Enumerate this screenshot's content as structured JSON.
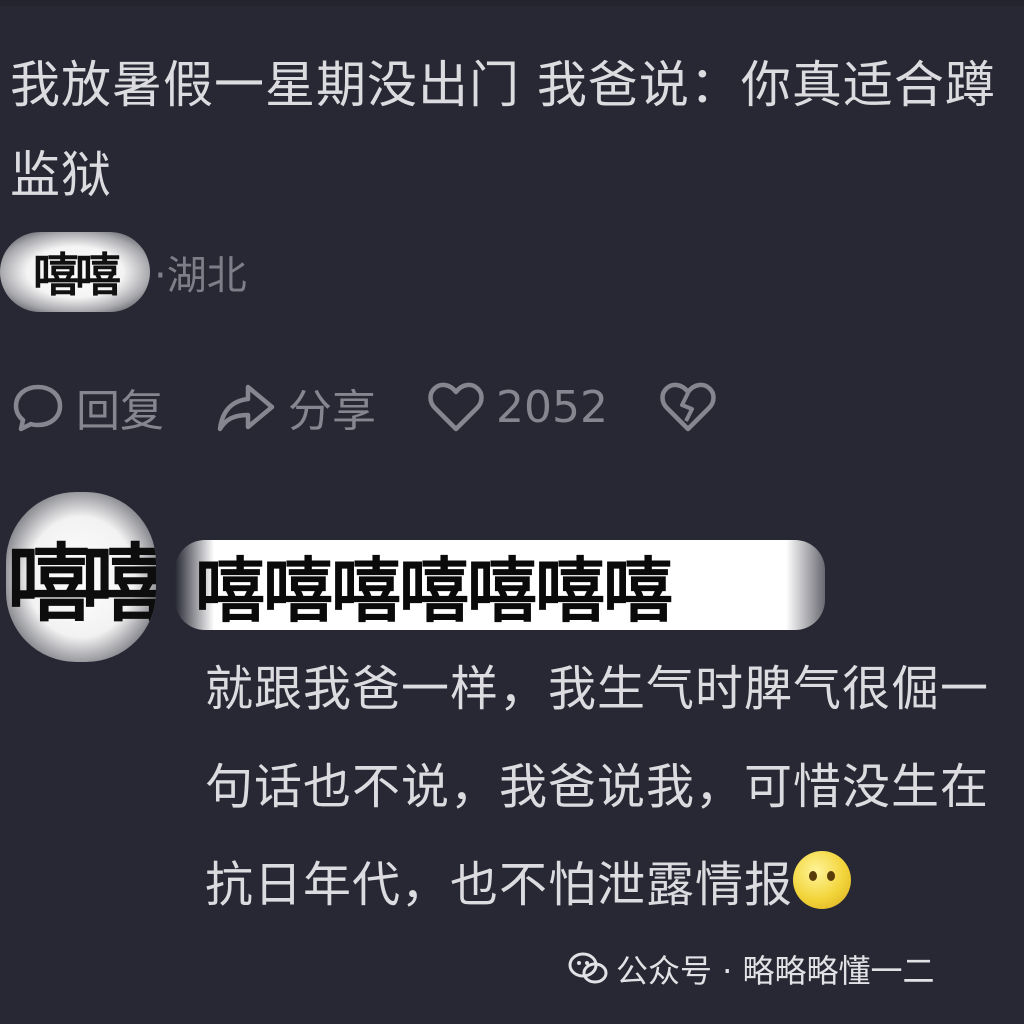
{
  "comment": {
    "text": "我放暑假一星期没出门 我爸说：你真适合蹲监狱",
    "username_blurred": "嘻嘻",
    "location": "·湖北"
  },
  "actions": {
    "reply_label": "回复",
    "share_label": "分享",
    "like_count": "2052"
  },
  "reply": {
    "avatar_text": "嘻嘻",
    "username": "嘻嘻嘻嘻嘻嘻嘻",
    "text": "就跟我爸一样，我生气时脾气很倔一句话也不说，我爸说我，可惜没生在抗日年代，也不怕泄露情报"
  },
  "watermark": {
    "text": "公众号 · 略略略懂一二"
  },
  "colors": {
    "background": "#272833",
    "text": "#dcdce0",
    "muted": "#85868f"
  },
  "icons": [
    "comment-icon",
    "share-arrow-icon",
    "heart-icon",
    "broken-heart-icon",
    "wechat-icon",
    "emoji-icon"
  ]
}
